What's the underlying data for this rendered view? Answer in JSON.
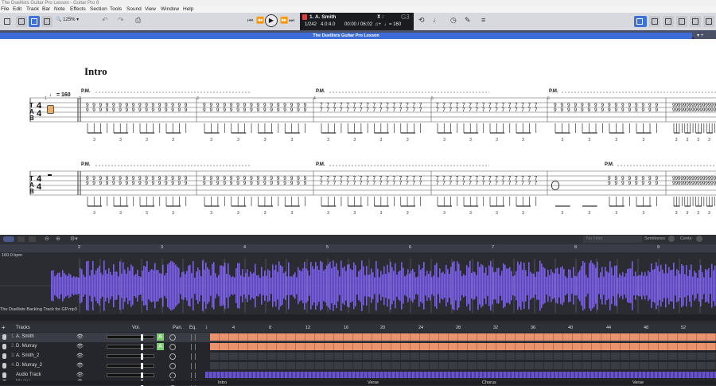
{
  "window_title": "The Duellists Guitar Pro Lesson - Guitar Pro 8",
  "menu": [
    "File",
    "Edit",
    "Track",
    "Bar",
    "Note",
    "Effects",
    "Section",
    "Tools",
    "Sound",
    "View",
    "Window",
    "Help"
  ],
  "toolbar": {
    "zoom": "125%"
  },
  "lcd": {
    "track": "1. A. Smith",
    "bar_pos": "1/242",
    "beat": "4.0:4.0",
    "time": "00:00 / 06:02",
    "tempo": "160",
    "key": "G3"
  },
  "document_title": "The Duellists Guitar Pro Lesson",
  "score": {
    "section": "Intro",
    "tempo_mark": "= 160",
    "pm": "P.M.",
    "time_sig_top": "4",
    "time_sig_bottom": "4",
    "tab_label": [
      "T",
      "A",
      "B"
    ],
    "bar_numbers": [
      "1",
      "2",
      "3",
      "4",
      "5",
      "6"
    ]
  },
  "midbar": {
    "filter": "No Filter",
    "semitones": "Semitones",
    "cents": "Cents"
  },
  "waveform": {
    "bpm": "160.0 bpm",
    "file": "The Duellists Backing Track for GP.mp3",
    "markers": [
      "2",
      "3",
      "4",
      "5",
      "6",
      "7",
      "8",
      "9"
    ]
  },
  "tracks_panel": {
    "header": "Tracks",
    "vol": "Vol.",
    "pan": "Pan.",
    "eq": "Eq.",
    "ruler": [
      "1",
      "4",
      "8",
      "12",
      "16",
      "20",
      "24",
      "28",
      "32",
      "36",
      "40",
      "44",
      "48",
      "52"
    ],
    "tracks": [
      {
        "num": "1.",
        "name": "A. Smith"
      },
      {
        "num": "2.",
        "name": "D. Murray"
      },
      {
        "num": "3.",
        "name": "A. Smith_2"
      },
      {
        "num": "4.",
        "name": "D. Murray_2"
      },
      {
        "num": "",
        "name": "Audio Track"
      },
      {
        "num": "",
        "name": "Master"
      }
    ],
    "sections": [
      "Intro",
      "Verse",
      "Chorus",
      "Verse"
    ]
  },
  "colors": {
    "accent": "#3f72d8",
    "wave": "#7a63d6",
    "track_block": "#e8926e",
    "audio_block": "#6a55c8"
  }
}
